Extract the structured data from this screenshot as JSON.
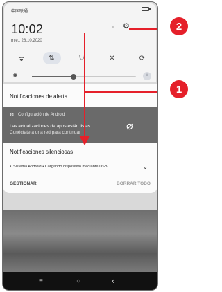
{
  "status": {
    "carrier": "中国联通"
  },
  "clock": {
    "time": "10:02",
    "date": "mié., 28.10.2020"
  },
  "icons": {
    "signal": "signal-icon",
    "settings": "gear-icon",
    "wifi": "wifi-off-icon",
    "data": "mobile-data-icon",
    "torch": "flashlight-icon",
    "bluetooth": "bluetooth-off-icon",
    "rotate": "auto-rotate-icon",
    "brightness": "brightness-icon",
    "auto": "auto-brightness-icon"
  },
  "brightness": {
    "level": 0.4,
    "auto_label": "A"
  },
  "notifications": {
    "alert_header": "Notificaciones de alerta",
    "alert_app": "Configuración de Android",
    "alert_title": "Las actualizaciones de apps están listas",
    "alert_text": "Conéctate a una red para continuar",
    "silent_header": "Notificaciones silenciosas",
    "silent_row": "Sistema Android • Cargando dispositivo mediante USB",
    "manage": "GESTIONAR",
    "clear_all": "BORRAR TODO"
  },
  "nav": {
    "menu_icon": "≡",
    "home_icon": "○",
    "back_icon": "‹"
  },
  "callouts": {
    "one": "1",
    "two": "2"
  },
  "colors": {
    "accent": "#e5202a",
    "notification_bg": "#6a6a6a"
  }
}
